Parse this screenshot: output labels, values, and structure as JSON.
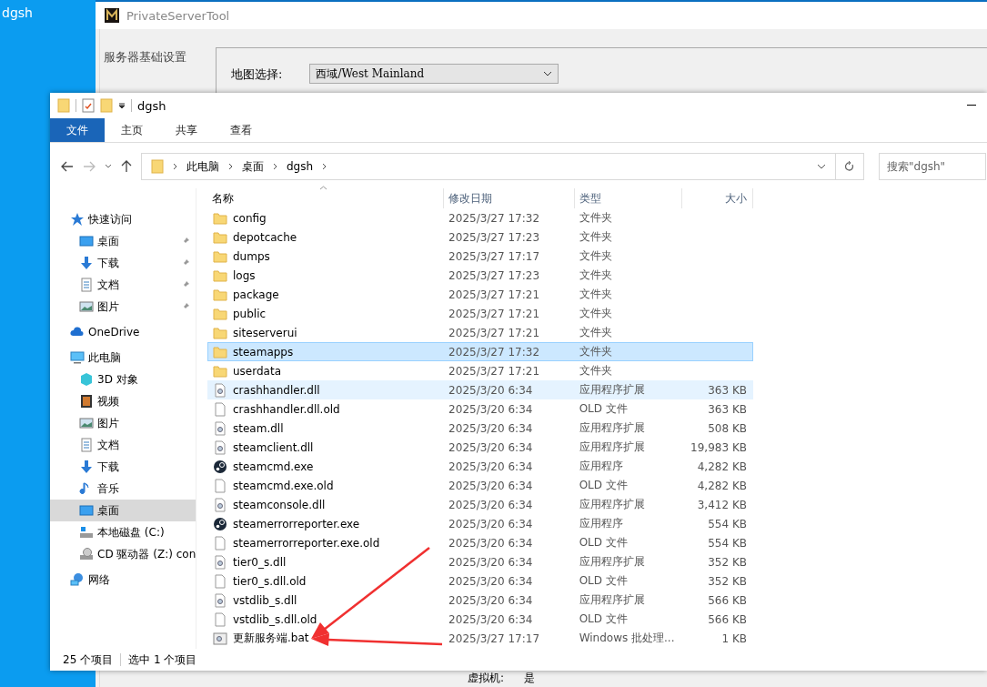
{
  "desktop": {
    "icon_label": "dgsh"
  },
  "server_tool": {
    "title": "PrivateServerTool",
    "sidebar_item": "服务器基础设置",
    "map_label": "地图选择:",
    "map_value": "西域/West Mainland",
    "vm_label": "虚拟机:",
    "vm_value": "是"
  },
  "explorer": {
    "title": "dgsh",
    "ribbon_tabs": [
      {
        "label": "文件",
        "selected": true
      },
      {
        "label": "主页",
        "selected": false
      },
      {
        "label": "共享",
        "selected": false
      },
      {
        "label": "查看",
        "selected": false
      }
    ],
    "breadcrumb": [
      "此电脑",
      "桌面",
      "dgsh"
    ],
    "search": {
      "placeholder": "搜索\"dgsh\""
    },
    "nav": [
      {
        "label": "快速访问",
        "kind": "star",
        "selected": false,
        "children": [
          {
            "label": "桌面",
            "kind": "desktop",
            "pinned": true,
            "selected": false
          },
          {
            "label": "下载",
            "kind": "download",
            "pinned": true,
            "selected": false
          },
          {
            "label": "文档",
            "kind": "document",
            "pinned": true,
            "selected": false
          },
          {
            "label": "图片",
            "kind": "picture",
            "pinned": true,
            "selected": false
          }
        ]
      },
      {
        "label": "OneDrive",
        "kind": "cloud",
        "selected": false
      },
      {
        "label": "此电脑",
        "kind": "pc",
        "selected": false,
        "children": [
          {
            "label": "3D 对象",
            "kind": "cube",
            "pinned": false,
            "selected": false
          },
          {
            "label": "视频",
            "kind": "video",
            "pinned": false,
            "selected": false
          },
          {
            "label": "图片",
            "kind": "picture",
            "pinned": false,
            "selected": false
          },
          {
            "label": "文档",
            "kind": "document",
            "pinned": false,
            "selected": false
          },
          {
            "label": "下载",
            "kind": "download",
            "pinned": false,
            "selected": false
          },
          {
            "label": "音乐",
            "kind": "music",
            "pinned": false,
            "selected": false
          },
          {
            "label": "桌面",
            "kind": "desktop",
            "pinned": false,
            "selected": true
          },
          {
            "label": "本地磁盘 (C:)",
            "kind": "disk",
            "pinned": false,
            "selected": false
          },
          {
            "label": "CD 驱动器 (Z:) con",
            "kind": "cd",
            "pinned": false,
            "selected": false
          }
        ]
      },
      {
        "label": "网络",
        "kind": "network",
        "selected": false
      }
    ],
    "columns": [
      "名称",
      "修改日期",
      "类型",
      "大小"
    ],
    "rows": [
      {
        "name": "config",
        "date": "2025/3/27 17:32",
        "type": "文件夹",
        "kind": "folder",
        "selected": false,
        "hovered": false
      },
      {
        "name": "depotcache",
        "date": "2025/3/27 17:23",
        "type": "文件夹",
        "kind": "folder",
        "selected": false,
        "hovered": false
      },
      {
        "name": "dumps",
        "date": "2025/3/27 17:17",
        "type": "文件夹",
        "kind": "folder",
        "selected": false,
        "hovered": false
      },
      {
        "name": "logs",
        "date": "2025/3/27 17:23",
        "type": "文件夹",
        "kind": "folder",
        "selected": false,
        "hovered": false
      },
      {
        "name": "package",
        "date": "2025/3/27 17:21",
        "type": "文件夹",
        "kind": "folder",
        "selected": false,
        "hovered": false
      },
      {
        "name": "public",
        "date": "2025/3/27 17:21",
        "type": "文件夹",
        "kind": "folder",
        "selected": false,
        "hovered": false
      },
      {
        "name": "siteserverui",
        "date": "2025/3/27 17:21",
        "type": "文件夹",
        "kind": "folder",
        "selected": false,
        "hovered": false
      },
      {
        "name": "steamapps",
        "date": "2025/3/27 17:32",
        "type": "文件夹",
        "kind": "folder",
        "selected": true,
        "hovered": false
      },
      {
        "name": "userdata",
        "date": "2025/3/27 17:21",
        "type": "文件夹",
        "kind": "folder",
        "selected": false,
        "hovered": false
      },
      {
        "name": "crashhandler.dll",
        "date": "2025/3/20 6:34",
        "type": "应用程序扩展",
        "size": "363 KB",
        "kind": "dll",
        "selected": false,
        "hovered": true
      },
      {
        "name": "crashhandler.dll.old",
        "date": "2025/3/20 6:34",
        "type": "OLD 文件",
        "size": "363 KB",
        "kind": "file",
        "selected": false,
        "hovered": false
      },
      {
        "name": "steam.dll",
        "date": "2025/3/20 6:34",
        "type": "应用程序扩展",
        "size": "508 KB",
        "kind": "dll",
        "selected": false,
        "hovered": false
      },
      {
        "name": "steamclient.dll",
        "date": "2025/3/20 6:34",
        "type": "应用程序扩展",
        "size": "19,983 KB",
        "kind": "dll",
        "selected": false,
        "hovered": false
      },
      {
        "name": "steamcmd.exe",
        "date": "2025/3/20 6:34",
        "type": "应用程序",
        "size": "4,282 KB",
        "kind": "exe",
        "selected": false,
        "hovered": false
      },
      {
        "name": "steamcmd.exe.old",
        "date": "2025/3/20 6:34",
        "type": "OLD 文件",
        "size": "4,282 KB",
        "kind": "file",
        "selected": false,
        "hovered": false
      },
      {
        "name": "steamconsole.dll",
        "date": "2025/3/20 6:34",
        "type": "应用程序扩展",
        "size": "3,412 KB",
        "kind": "dll",
        "selected": false,
        "hovered": false
      },
      {
        "name": "steamerrorreporter.exe",
        "date": "2025/3/20 6:34",
        "type": "应用程序",
        "size": "554 KB",
        "kind": "exe",
        "selected": false,
        "hovered": false
      },
      {
        "name": "steamerrorreporter.exe.old",
        "date": "2025/3/20 6:34",
        "type": "OLD 文件",
        "size": "554 KB",
        "kind": "file",
        "selected": false,
        "hovered": false
      },
      {
        "name": "tier0_s.dll",
        "date": "2025/3/20 6:34",
        "type": "应用程序扩展",
        "size": "352 KB",
        "kind": "dll",
        "selected": false,
        "hovered": false
      },
      {
        "name": "tier0_s.dll.old",
        "date": "2025/3/20 6:34",
        "type": "OLD 文件",
        "size": "352 KB",
        "kind": "file",
        "selected": false,
        "hovered": false
      },
      {
        "name": "vstdlib_s.dll",
        "date": "2025/3/20 6:34",
        "type": "应用程序扩展",
        "size": "566 KB",
        "kind": "dll",
        "selected": false,
        "hovered": false
      },
      {
        "name": "vstdlib_s.dll.old",
        "date": "2025/3/20 6:34",
        "type": "OLD 文件",
        "size": "566 KB",
        "kind": "file",
        "selected": false,
        "hovered": false
      },
      {
        "name": "更新服务端.bat",
        "date": "2025/3/27 17:17",
        "type": "Windows 批处理...",
        "size": "1 KB",
        "kind": "bat",
        "selected": false,
        "hovered": false
      }
    ],
    "status": {
      "count": "25 个项目",
      "selection": "选中 1 个项目"
    }
  }
}
